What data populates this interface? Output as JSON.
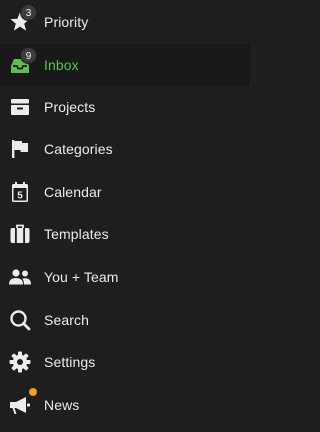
{
  "colors": {
    "background": "#1e1e1e",
    "active_background": "#191919",
    "text": "#ececec",
    "active_text": "#5bbf4f",
    "icon": "#ececec",
    "badge_background": "#3c3c3c",
    "notification_dot": "#f0a020"
  },
  "nav": {
    "items": [
      {
        "label": "Priority",
        "icon": "star-icon",
        "badge": "3"
      },
      {
        "label": "Inbox",
        "icon": "inbox-icon",
        "badge": "9",
        "active": true
      },
      {
        "label": "Projects",
        "icon": "projects-icon"
      },
      {
        "label": "Categories",
        "icon": "flag-icon"
      },
      {
        "label": "Calendar",
        "icon": "calendar-icon",
        "glyph": "5"
      },
      {
        "label": "Templates",
        "icon": "briefcase-icon"
      },
      {
        "label": "You + Team",
        "icon": "team-icon"
      },
      {
        "label": "Search",
        "icon": "search-icon"
      },
      {
        "label": "Settings",
        "icon": "gear-icon"
      },
      {
        "label": "News",
        "icon": "megaphone-icon",
        "notification": true
      }
    ]
  }
}
